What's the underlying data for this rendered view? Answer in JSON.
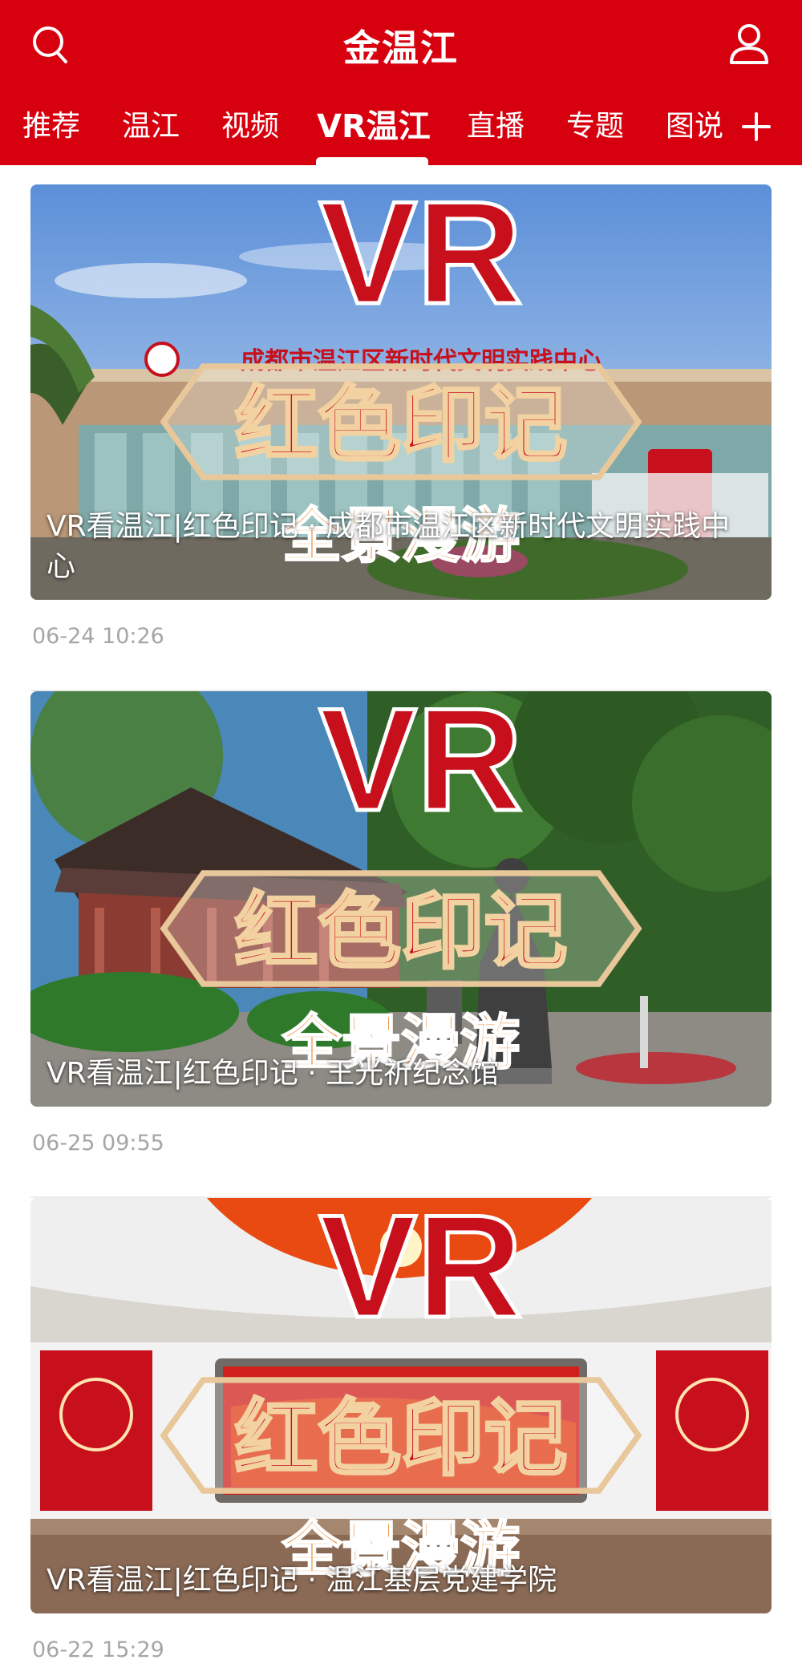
{
  "header": {
    "title": "金温江"
  },
  "tabs": [
    {
      "label": "推荐"
    },
    {
      "label": "温江"
    },
    {
      "label": "视频"
    },
    {
      "label": "VR温江"
    },
    {
      "label": "直播"
    },
    {
      "label": "专题"
    },
    {
      "label": "图说"
    }
  ],
  "badge": {
    "vr": "VR",
    "line1": "红色印记",
    "line2": "全景漫游"
  },
  "feed": [
    {
      "title": " VR看温江|红色印记 · 成都市温江区新时代文明实践中心",
      "sign": "成都市温江区新时代文明实践中心",
      "time": "06-24 10:26"
    },
    {
      "title": "VR看温江|红色印记 · 王光祈纪念馆",
      "time": "06-25 09:55"
    },
    {
      "title": "VR看温江|红色印记 · 温江基层党建学院",
      "time": "06-22 15:29"
    }
  ],
  "colors": {
    "brand_red": "#d7000f",
    "time_gray": "#a6a6a6"
  },
  "icons": {
    "search": "search-icon",
    "user": "user-icon",
    "add": "plus-icon"
  }
}
